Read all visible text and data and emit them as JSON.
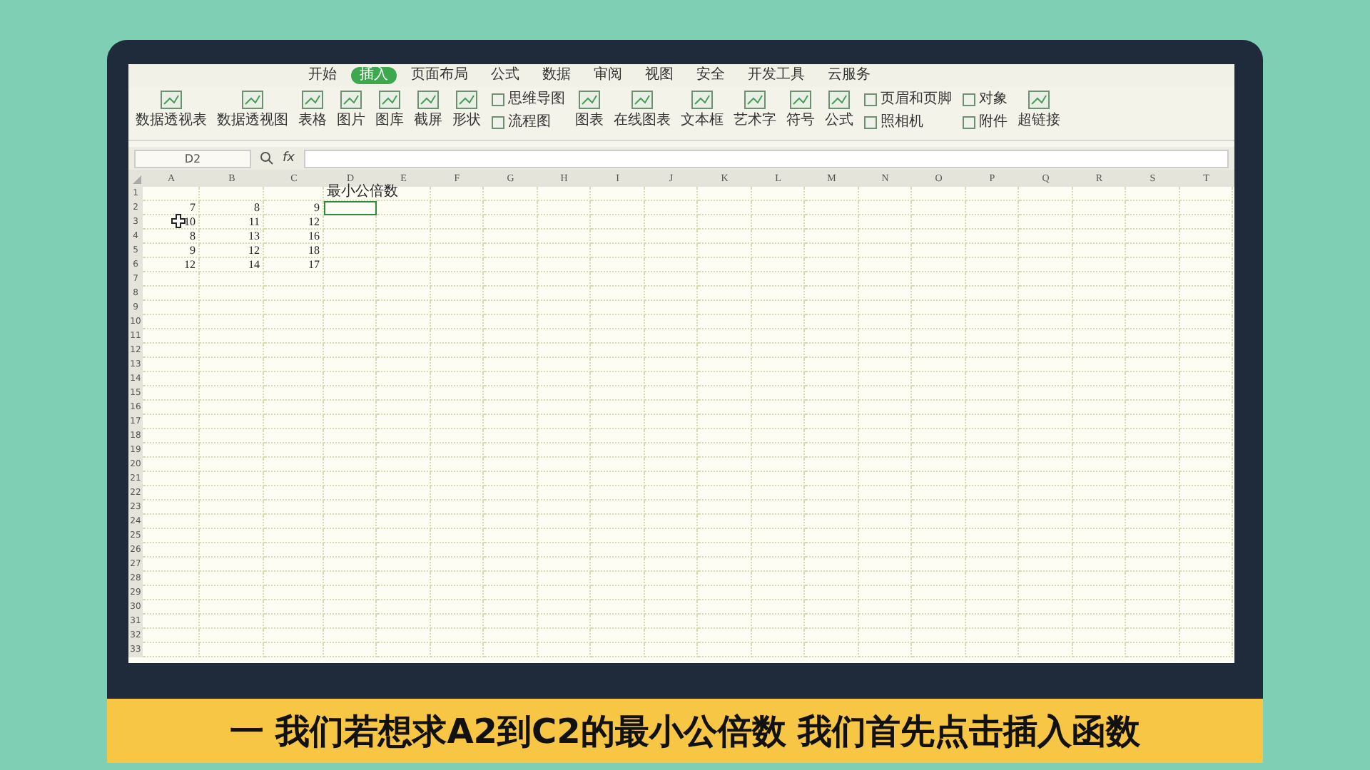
{
  "menu_tabs": [
    {
      "label": "开始",
      "selected": false
    },
    {
      "label": "插入",
      "selected": true
    },
    {
      "label": "页面布局",
      "selected": false
    },
    {
      "label": "公式",
      "selected": false
    },
    {
      "label": "数据",
      "selected": false
    },
    {
      "label": "审阅",
      "selected": false
    },
    {
      "label": "视图",
      "selected": false
    },
    {
      "label": "安全",
      "selected": false
    },
    {
      "label": "开发工具",
      "selected": false
    },
    {
      "label": "云服务",
      "selected": false
    }
  ],
  "ribbon": [
    {
      "kind": "big",
      "labels": [
        "数据透视表"
      ]
    },
    {
      "kind": "big",
      "labels": [
        "数据透视图"
      ]
    },
    {
      "kind": "big",
      "labels": [
        "表格"
      ]
    },
    {
      "kind": "big",
      "labels": [
        "图片"
      ]
    },
    {
      "kind": "big",
      "labels": [
        "图库"
      ]
    },
    {
      "kind": "big",
      "labels": [
        "截屏"
      ]
    },
    {
      "kind": "big",
      "labels": [
        "形状"
      ]
    },
    {
      "kind": "small",
      "labels": [
        "思维导图",
        "流程图"
      ]
    },
    {
      "kind": "big",
      "labels": [
        "图表"
      ]
    },
    {
      "kind": "big",
      "labels": [
        "在线图表"
      ]
    },
    {
      "kind": "big",
      "labels": [
        "文本框"
      ]
    },
    {
      "kind": "big",
      "labels": [
        "艺术字"
      ]
    },
    {
      "kind": "big",
      "labels": [
        "符号"
      ]
    },
    {
      "kind": "big",
      "labels": [
        "公式"
      ]
    },
    {
      "kind": "small",
      "labels": [
        "页眉和页脚",
        "照相机"
      ]
    },
    {
      "kind": "small",
      "labels": [
        "对象",
        "附件"
      ]
    },
    {
      "kind": "big",
      "labels": [
        "超链接"
      ]
    }
  ],
  "name_box": "D2",
  "formula_label": "fx",
  "columns": [
    "A",
    "B",
    "C",
    "D",
    "E",
    "F",
    "G",
    "H",
    "I",
    "J",
    "K",
    "L",
    "M",
    "N",
    "O",
    "P",
    "Q",
    "R",
    "S",
    "T"
  ],
  "rows": [
    {
      "number": "1",
      "cells": [
        {
          "selected": false
        },
        {
          "selected": false
        },
        {
          "selected": false
        },
        {
          "text": "最小公倍数",
          "kind": "text",
          "selected": false
        }
      ]
    },
    {
      "number": "2",
      "cells": [
        {
          "text": "7",
          "kind": "number",
          "selected": false
        },
        {
          "text": "8",
          "kind": "number",
          "selected": false
        },
        {
          "text": "9",
          "kind": "number",
          "selected": false
        },
        {
          "selected": true
        }
      ]
    },
    {
      "number": "3",
      "cells": [
        {
          "text": "10",
          "kind": "number",
          "selected": false
        },
        {
          "text": "11",
          "kind": "number",
          "selected": false
        },
        {
          "text": "12",
          "kind": "number",
          "selected": false
        },
        {
          "selected": false
        }
      ]
    },
    {
      "number": "4",
      "cells": [
        {
          "text": "8",
          "kind": "number",
          "selected": false
        },
        {
          "text": "13",
          "kind": "number",
          "selected": false
        },
        {
          "text": "16",
          "kind": "number",
          "selected": false
        },
        {
          "selected": false
        }
      ]
    },
    {
      "number": "5",
      "cells": [
        {
          "text": "9",
          "kind": "number",
          "selected": false
        },
        {
          "text": "12",
          "kind": "number",
          "selected": false
        },
        {
          "text": "18",
          "kind": "number",
          "selected": false
        },
        {
          "selected": false
        }
      ]
    },
    {
      "number": "6",
      "cells": [
        {
          "text": "12",
          "kind": "number",
          "selected": false
        },
        {
          "text": "14",
          "kind": "number",
          "selected": false
        },
        {
          "text": "17",
          "kind": "number",
          "selected": false
        },
        {
          "selected": false
        }
      ]
    },
    {
      "number": "7"
    },
    {
      "number": "8"
    },
    {
      "number": "9"
    },
    {
      "number": "10"
    },
    {
      "number": "11"
    },
    {
      "number": "12"
    },
    {
      "number": "13"
    },
    {
      "number": "14"
    },
    {
      "number": "15"
    },
    {
      "number": "16"
    },
    {
      "number": "17"
    },
    {
      "number": "18"
    },
    {
      "number": "19"
    },
    {
      "number": "20"
    },
    {
      "number": "21"
    },
    {
      "number": "22"
    },
    {
      "number": "23"
    },
    {
      "number": "24"
    },
    {
      "number": "25"
    },
    {
      "number": "26"
    },
    {
      "number": "27"
    },
    {
      "number": "28"
    },
    {
      "number": "29"
    },
    {
      "number": "30"
    },
    {
      "number": "31"
    },
    {
      "number": "32"
    },
    {
      "number": "33"
    }
  ],
  "subtitle": "一 我们若想求A2到C2的最小公倍数 我们首先点击插入函数"
}
